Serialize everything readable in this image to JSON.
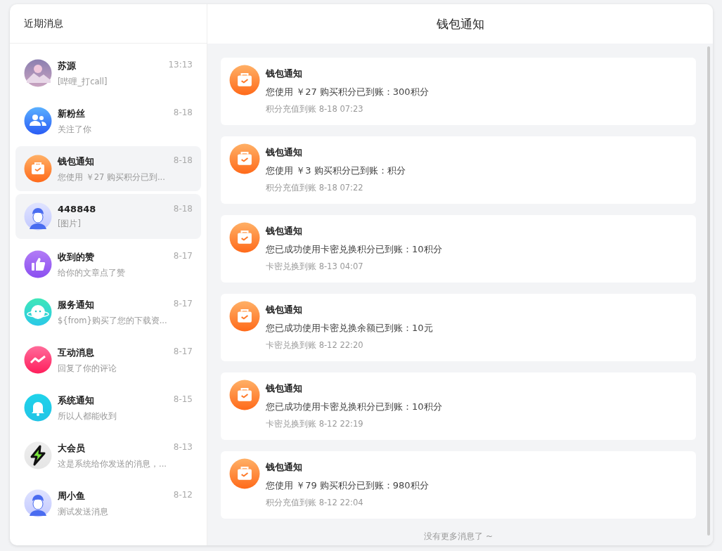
{
  "sidebar": {
    "title": "近期消息",
    "items": [
      {
        "name": "苏源",
        "time": "13:13",
        "preview": "[哔哩_打call]",
        "kind": "photo",
        "selected": false
      },
      {
        "name": "新粉丝",
        "time": "8-18",
        "preview": "关注了你",
        "kind": "fans",
        "selected": false
      },
      {
        "name": "钱包通知",
        "time": "8-18",
        "preview": "您使用 ￥27 购买积分已到...",
        "kind": "wallet",
        "selected": true
      },
      {
        "name": "448848",
        "time": "8-18",
        "preview": "[图片]",
        "kind": "person",
        "selected": true
      },
      {
        "name": "收到的赞",
        "time": "8-17",
        "preview": "给你的文章点了赞",
        "kind": "like",
        "selected": false
      },
      {
        "name": "服务通知",
        "time": "8-17",
        "preview": "${from}购买了您的下载资...",
        "kind": "service",
        "selected": false
      },
      {
        "name": "互动消息",
        "time": "8-17",
        "preview": "回复了你的评论",
        "kind": "interaction",
        "selected": false
      },
      {
        "name": "系统通知",
        "time": "8-15",
        "preview": "所以人都能收到",
        "kind": "system",
        "selected": false
      },
      {
        "name": "大会员",
        "time": "8-13",
        "preview": "这是系统给你发送的消息，...",
        "kind": "vip",
        "selected": false
      },
      {
        "name": "周小鱼",
        "time": "8-12",
        "preview": "测试发送消息",
        "kind": "person",
        "selected": false
      }
    ]
  },
  "conversation": {
    "title": "钱包通知",
    "messages": [
      {
        "sender": "钱包通知",
        "text": "您使用 ￥27 购买积分已到账：300积分",
        "meta": "积分充值到账 8-18 07:23"
      },
      {
        "sender": "钱包通知",
        "text": "您使用 ￥3 购买积分已到账：积分",
        "meta": "积分充值到账 8-18 07:22"
      },
      {
        "sender": "钱包通知",
        "text": "您已成功使用卡密兑换积分已到账：10积分",
        "meta": "卡密兑换到账 8-13 04:07"
      },
      {
        "sender": "钱包通知",
        "text": "您已成功使用卡密兑换余额已到账：10元",
        "meta": "卡密兑换到账 8-12 22:20"
      },
      {
        "sender": "钱包通知",
        "text": "您已成功使用卡密兑换积分已到账：10积分",
        "meta": "卡密兑换到账 8-12 22:19"
      },
      {
        "sender": "钱包通知",
        "text": "您使用 ￥79 购买积分已到账：980积分",
        "meta": "积分充值到账 8-12 22:04"
      }
    ],
    "footer": "没有更多消息了 ~"
  }
}
